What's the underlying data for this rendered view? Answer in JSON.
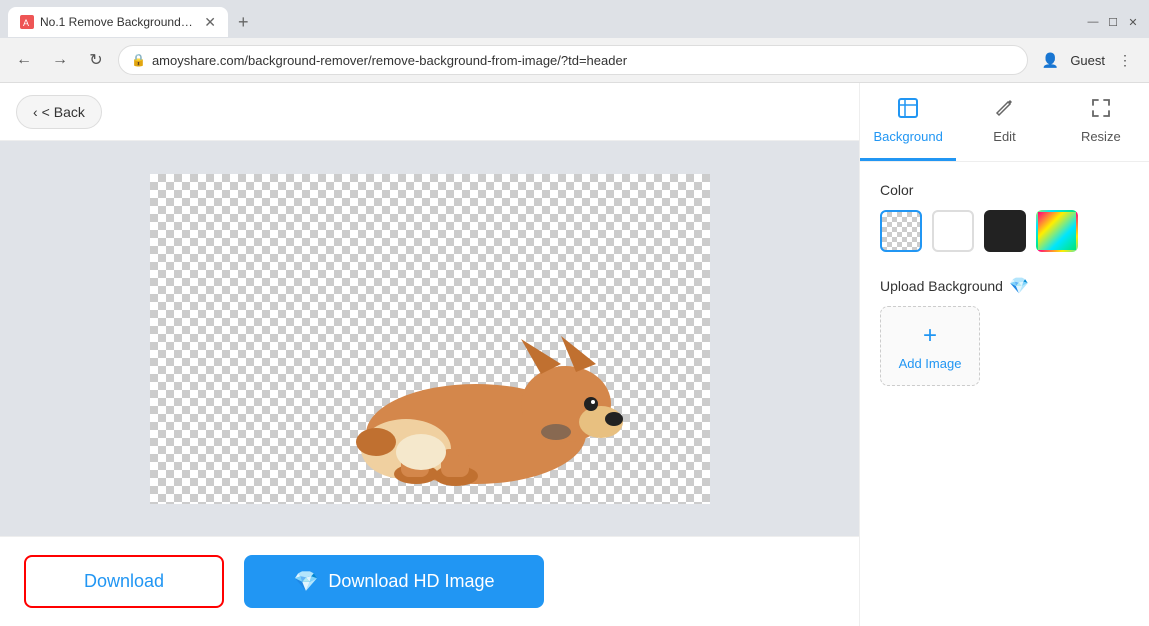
{
  "browser": {
    "tab_title": "No.1 Remove Background from",
    "tab_favicon_color": "#e53935",
    "new_tab_label": "+",
    "url": "amoyshare.com/background-remover/remove-background-from-image/?td=header",
    "window_controls": [
      "—",
      "☐",
      "✕"
    ]
  },
  "toolbar": {
    "back_label": "< Back"
  },
  "panel": {
    "tabs": [
      {
        "id": "background",
        "label": "Background",
        "icon": "⊟",
        "active": true
      },
      {
        "id": "edit",
        "label": "Edit",
        "icon": "✏",
        "active": false
      },
      {
        "id": "resize",
        "label": "Resize",
        "icon": "⤢",
        "active": false
      }
    ],
    "color_section_label": "Color",
    "swatches": [
      {
        "id": "transparent",
        "type": "transparent",
        "selected": true
      },
      {
        "id": "white",
        "type": "white",
        "selected": false
      },
      {
        "id": "black",
        "type": "black",
        "selected": false
      },
      {
        "id": "gradient",
        "type": "gradient",
        "selected": false
      }
    ],
    "upload_bg_label": "Upload Background",
    "add_image_label": "Add Image"
  },
  "bottom_bar": {
    "download_label": "Download",
    "download_hd_label": "Download HD Image"
  }
}
